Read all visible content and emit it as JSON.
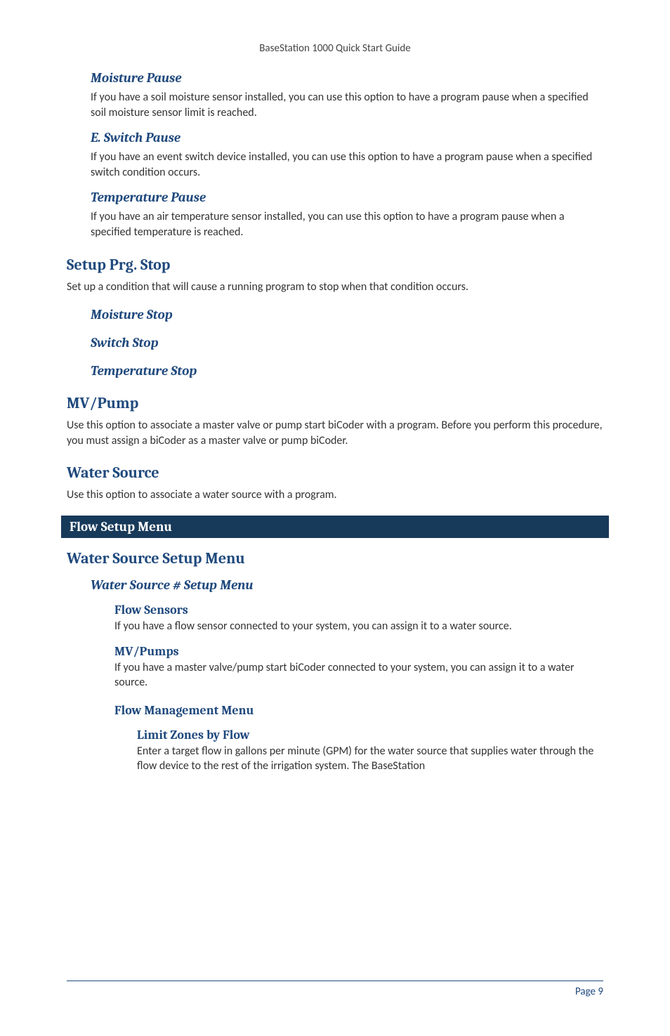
{
  "header": {
    "running": "BaseStation 1000 Quick Start Guide"
  },
  "footer": {
    "page_label": "Page 9"
  },
  "sections": {
    "moisture_pause": {
      "title": "Moisture Pause",
      "body": "If you have a soil moisture sensor installed, you can use this option to have a program pause when a specified soil moisture sensor limit is reached."
    },
    "switch_pause": {
      "title": "E. Switch Pause",
      "body": "If you have an event switch device installed, you can use this option to have a program pause when a specified switch condition occurs."
    },
    "temp_pause": {
      "title": "Temperature Pause",
      "body": "If you have an air temperature sensor installed, you can use this option to have a program pause when a specified temperature is reached."
    },
    "setup_stop": {
      "title": "Setup Prg. Stop",
      "body": "Set up a condition that will cause a running program to stop when that condition occurs.",
      "moisture": "Moisture Stop",
      "switch": "Switch Stop",
      "temp": "Temperature Stop"
    },
    "mv_pump": {
      "title": "MV/Pump",
      "body": "Use this option to associate a master valve or pump start biCoder with a program. Before you perform this procedure, you must assign a biCoder as a master valve or pump biCoder."
    },
    "water_source": {
      "title": "Water Source",
      "body": "Use this option to associate a water source with a program."
    },
    "flow_menu": {
      "band": "Flow Setup Menu"
    },
    "ws_setup": {
      "title": "Water Source Setup Menu",
      "subtitle": "Water Source # Setup Menu",
      "flow_sensors": {
        "title": "Flow Sensors",
        "body": "If you have a flow sensor connected to your system, you can assign it to a water source."
      },
      "mv_pumps": {
        "title": "MV/Pumps",
        "body": "If you have a master valve/pump start biCoder connected to your system, you can assign it to a water source."
      },
      "flow_mgmt": {
        "title": "Flow Management Menu",
        "limit_zones": {
          "title": "Limit Zones by Flow",
          "body": "Enter a target flow in gallons per minute (GPM) for the water source that supplies water through the flow device to the rest of the irrigation system. The BaseStation"
        }
      }
    }
  }
}
